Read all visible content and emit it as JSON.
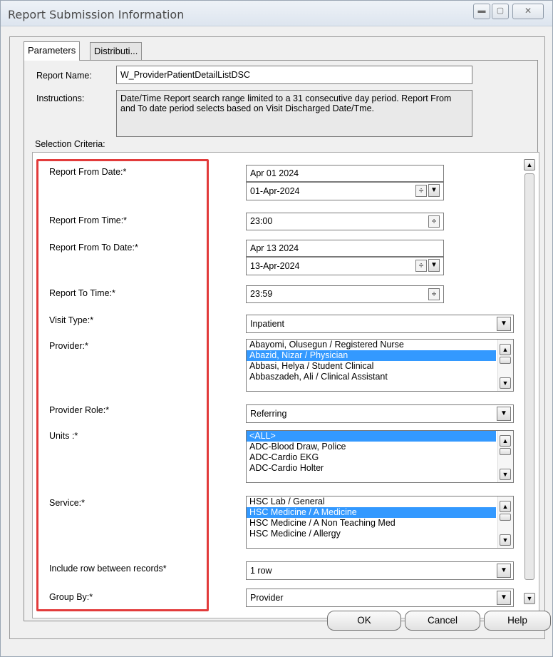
{
  "window": {
    "title": "Report Submission Information",
    "controls": [
      "minimize",
      "maximize",
      "close"
    ]
  },
  "tabs": [
    {
      "label": "Parameters",
      "active": true
    },
    {
      "label": "Distributi...",
      "active": false
    }
  ],
  "header": {
    "report_name_label": "Report Name:",
    "report_name_value": "W_ProviderPatientDetailListDSC",
    "instructions_label": "Instructions:",
    "instructions_text": "Date/Time Report search range limited to a 31 consecutive day period. Report From and To date period selects based on Visit Discharged Date/Tme.",
    "selection_criteria_label": "Selection Criteria:"
  },
  "fields": {
    "report_from_date": {
      "label": "Report From Date:*",
      "text": "Apr 01 2024",
      "spin_value": "01-Apr-2024"
    },
    "report_from_time": {
      "label": "Report From Time:*",
      "value": "23:00"
    },
    "report_to_date": {
      "label": "Report From To Date:*",
      "text": "Apr 13 2024",
      "spin_value": "13-Apr-2024"
    },
    "report_to_time": {
      "label": "Report To Time:*",
      "value": "23:59"
    },
    "visit_type": {
      "label": "Visit Type:*",
      "value": "Inpatient"
    },
    "provider": {
      "label": "Provider:*",
      "items": [
        {
          "text": "Abayomi, Olusegun / Registered Nurse",
          "selected": false
        },
        {
          "text": "Abazid, Nizar / Physician",
          "selected": true
        },
        {
          "text": "Abbasi, Helya / Student Clinical",
          "selected": false
        },
        {
          "text": "Abbaszadeh, Ali / Clinical Assistant",
          "selected": false
        }
      ]
    },
    "provider_role": {
      "label": "Provider Role:*",
      "value": "Referring"
    },
    "units": {
      "label": "Units :*",
      "items": [
        {
          "text": "<ALL>",
          "selected": true
        },
        {
          "text": "ADC-Blood Draw, Police",
          "selected": false
        },
        {
          "text": "ADC-Cardio EKG",
          "selected": false
        },
        {
          "text": "ADC-Cardio Holter",
          "selected": false
        }
      ]
    },
    "service": {
      "label": "Service:*",
      "items": [
        {
          "text": "HSC Lab / General",
          "selected": false
        },
        {
          "text": "HSC Medicine / A Medicine",
          "selected": true
        },
        {
          "text": "HSC Medicine / A Non Teaching Med",
          "selected": false
        },
        {
          "text": "HSC Medicine / Allergy",
          "selected": false
        }
      ]
    },
    "include_row": {
      "label": "Include row between records*",
      "value": "1 row"
    },
    "group_by": {
      "label": "Group By:*",
      "value": "Provider"
    }
  },
  "buttons": {
    "ok": "OK",
    "cancel": "Cancel",
    "help": "Help"
  },
  "colors": {
    "selection": "#3399ff",
    "highlight_border": "#e23b3b"
  }
}
